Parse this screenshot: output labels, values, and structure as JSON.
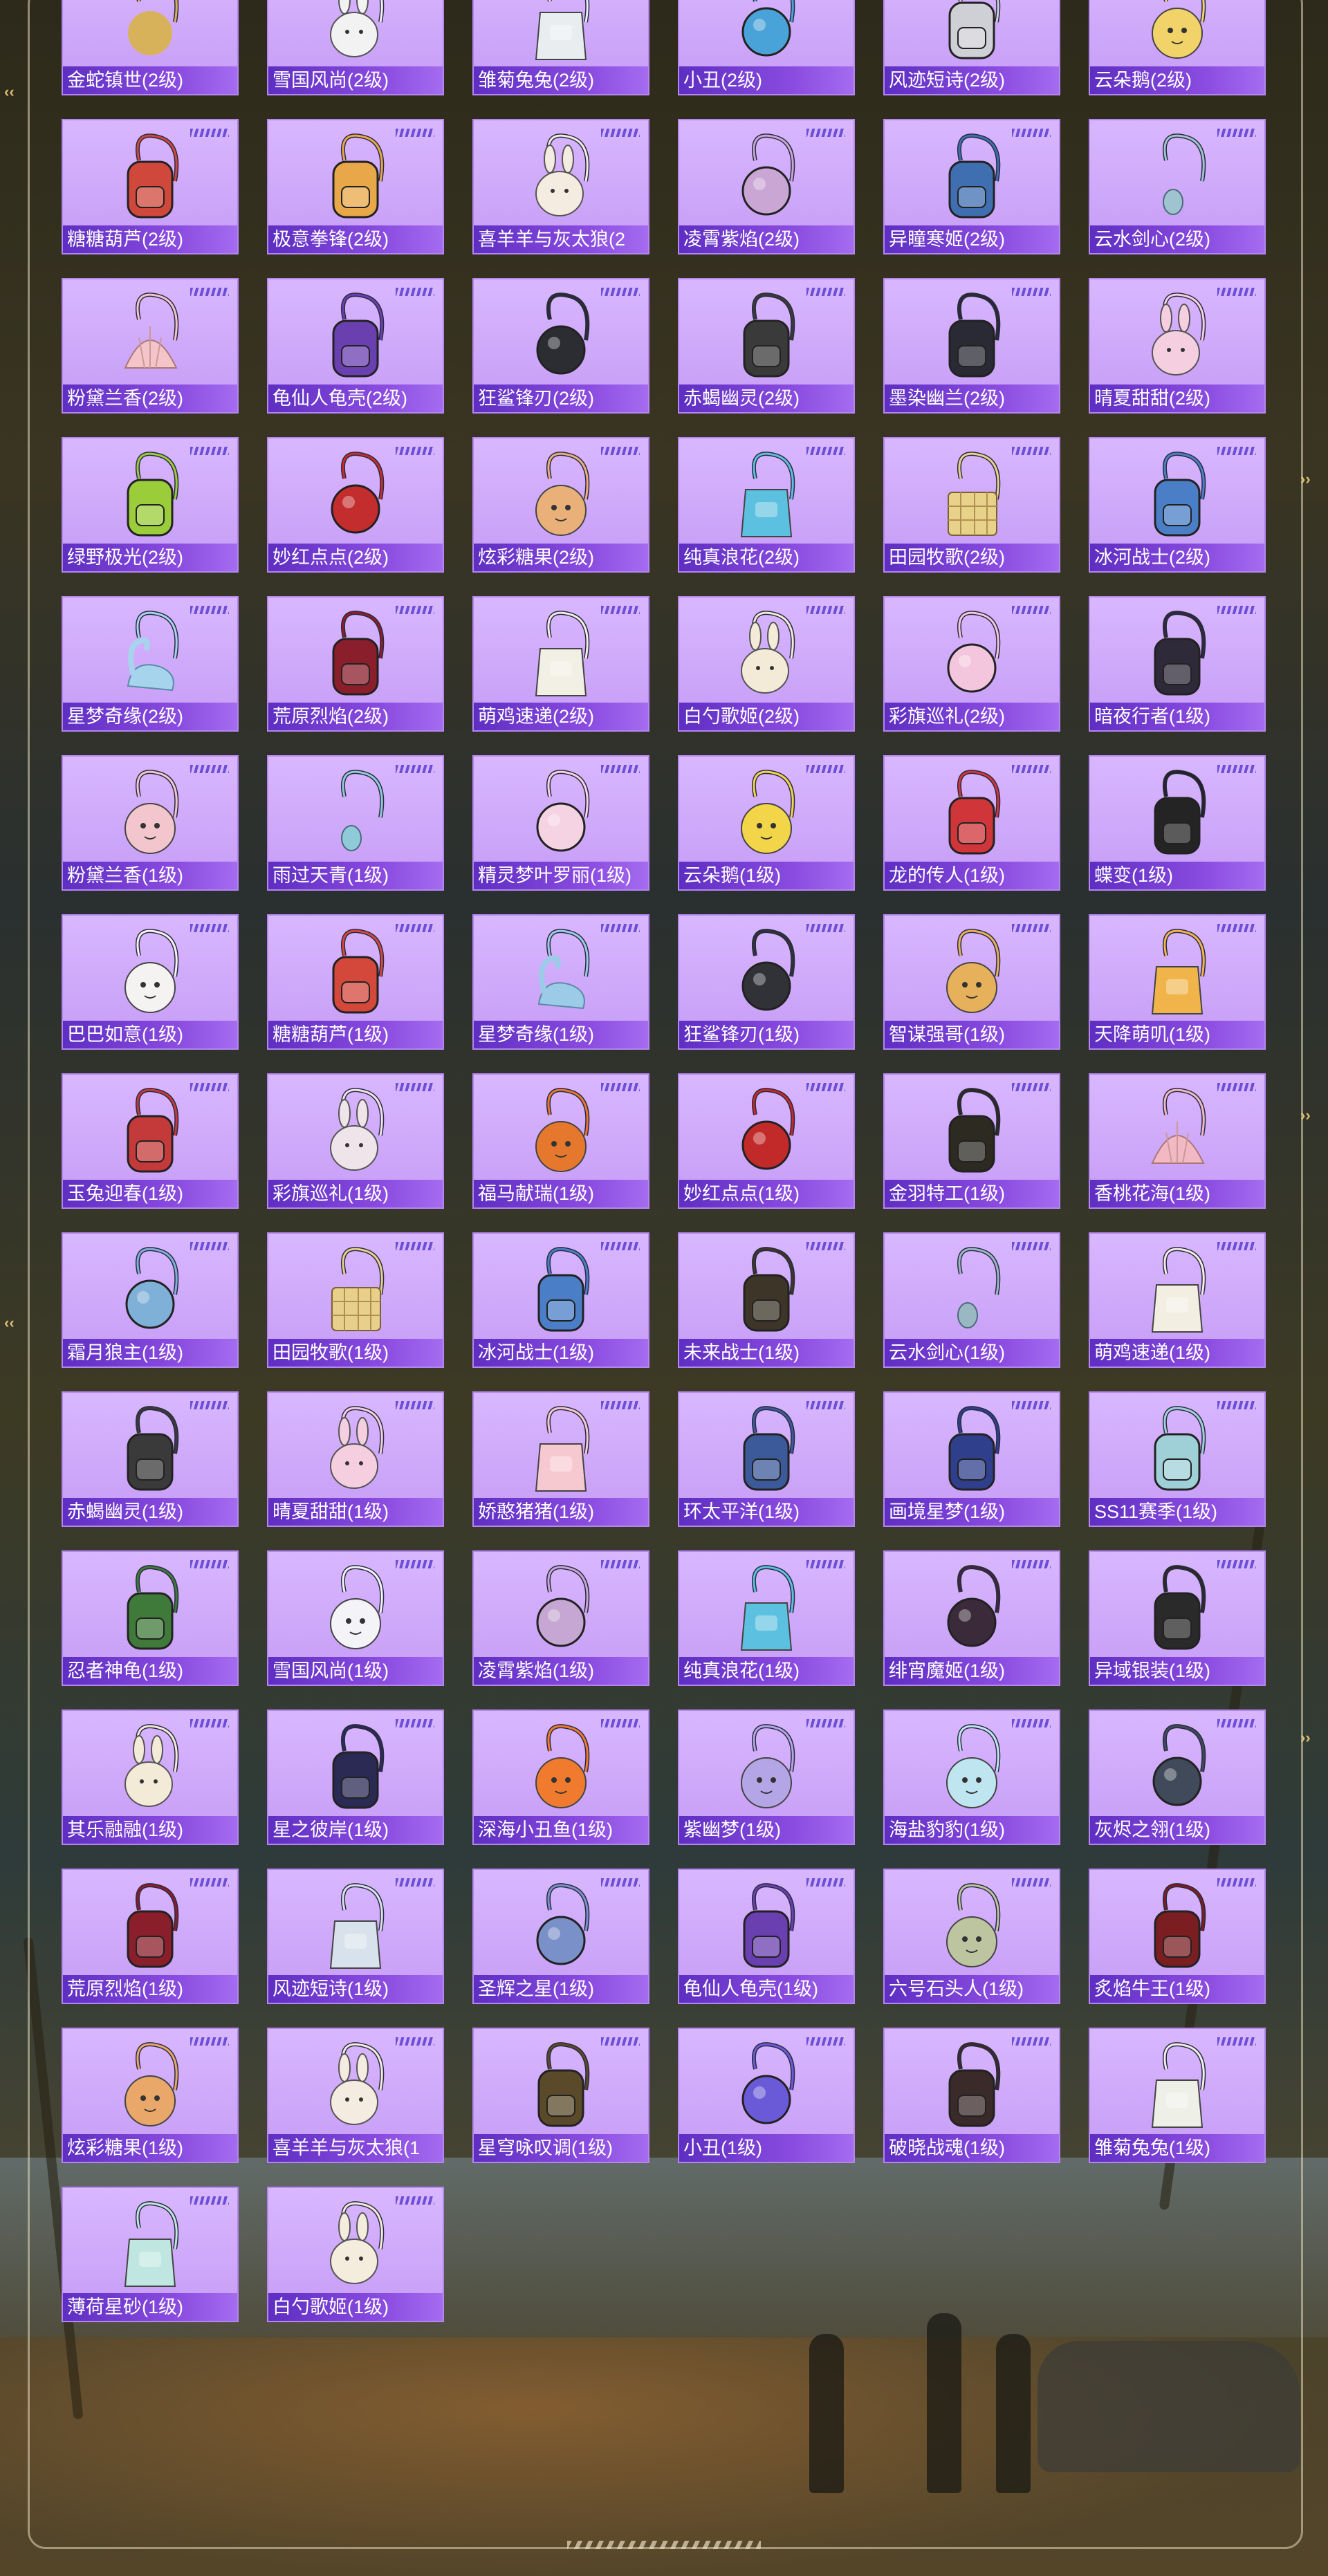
{
  "columns": 6,
  "card_colors": {
    "card": "#d4b0ff",
    "caption_bar": "#6a35cc",
    "text": "#ffffff",
    "accent_stripes": "#6b4fd6"
  },
  "items": [
    {
      "name": "金蛇镇世(2级)",
      "shape": "skull",
      "color": "#d8b25a"
    },
    {
      "name": "雪国风尚(2级)",
      "shape": "bunny",
      "color": "#f2f2f2"
    },
    {
      "name": "雏菊兔兔(2级)",
      "shape": "bag",
      "color": "#e8eef0"
    },
    {
      "name": "小丑(2级)",
      "shape": "orb",
      "color": "#4aa3d8"
    },
    {
      "name": "风迹短诗(2级)",
      "shape": "pack",
      "color": "#cfcfd6"
    },
    {
      "name": "云朵鹅(2级)",
      "shape": "round",
      "color": "#f2d36a"
    },
    {
      "name": "糖糖葫芦(2级)",
      "shape": "pack",
      "color": "#d0483c"
    },
    {
      "name": "极意拳锋(2级)",
      "shape": "pack",
      "color": "#e8a84a"
    },
    {
      "name": "喜羊羊与灰太狼(2",
      "shape": "bunny",
      "color": "#f4ece0"
    },
    {
      "name": "凌霄紫焰(2级)",
      "shape": "orb",
      "color": "#c9a6d4"
    },
    {
      "name": "异瞳寒姬(2级)",
      "shape": "pack",
      "color": "#3f6fb0"
    },
    {
      "name": "云水剑心(2级)",
      "shape": "strap",
      "color": "#9fc3cf"
    },
    {
      "name": "粉黛兰香(2级)",
      "shape": "shell",
      "color": "#f3c4c8"
    },
    {
      "name": "龟仙人龟壳(2级)",
      "shape": "pack",
      "color": "#6a3fb0"
    },
    {
      "name": "狂鲨锋刃(2级)",
      "shape": "orb",
      "color": "#2b2d33"
    },
    {
      "name": "赤蝎幽灵(2级)",
      "shape": "pack",
      "color": "#3a3a3a"
    },
    {
      "name": "墨染幽兰(2级)",
      "shape": "pack",
      "color": "#2a2a35"
    },
    {
      "name": "晴夏甜甜(2级)",
      "shape": "bunny",
      "color": "#f5cfe0"
    },
    {
      "name": "绿野极光(2级)",
      "shape": "pack",
      "color": "#9bcc3a"
    },
    {
      "name": "妙红点点(2级)",
      "shape": "orb",
      "color": "#c42d2d"
    },
    {
      "name": "炫彩糖果(2级)",
      "shape": "round",
      "color": "#e9b07a"
    },
    {
      "name": "纯真浪花(2级)",
      "shape": "bag",
      "color": "#5cc0e0"
    },
    {
      "name": "田园牧歌(2级)",
      "shape": "basket",
      "color": "#e8d28a"
    },
    {
      "name": "冰河战士(2级)",
      "shape": "pack",
      "color": "#4a7fc8"
    },
    {
      "name": "星梦奇缘(2级)",
      "shape": "swan",
      "color": "#a6d4ec"
    },
    {
      "name": "荒原烈焰(2级)",
      "shape": "pack",
      "color": "#8a1e2a"
    },
    {
      "name": "萌鸡速递(2级)",
      "shape": "bag",
      "color": "#f2efe4"
    },
    {
      "name": "白勺歌姬(2级)",
      "shape": "bunny",
      "color": "#f3ead8"
    },
    {
      "name": "彩旗巡礼(2级)",
      "shape": "orb",
      "color": "#f4c6de"
    },
    {
      "name": "暗夜行者(1级)",
      "shape": "pack",
      "color": "#2e2a3a"
    },
    {
      "name": "粉黛兰香(1级)",
      "shape": "round",
      "color": "#f2c6cc"
    },
    {
      "name": "雨过天青(1级)",
      "shape": "strap",
      "color": "#8fcad8"
    },
    {
      "name": "精灵梦叶罗丽(1级)",
      "shape": "orb",
      "color": "#f6d3e2"
    },
    {
      "name": "云朵鹅(1级)",
      "shape": "round",
      "color": "#f3d54a"
    },
    {
      "name": "龙的传人(1级)",
      "shape": "pack",
      "color": "#d0353a"
    },
    {
      "name": "蝶变(1级)",
      "shape": "pack",
      "color": "#242424"
    },
    {
      "name": "巴巴如意(1级)",
      "shape": "round",
      "color": "#f5f2f2"
    },
    {
      "name": "糖糖葫芦(1级)",
      "shape": "pack",
      "color": "#d4483c"
    },
    {
      "name": "星梦奇缘(1级)",
      "shape": "swan",
      "color": "#9ccbe8"
    },
    {
      "name": "狂鲨锋刃(1级)",
      "shape": "orb",
      "color": "#303238"
    },
    {
      "name": "智谋强哥(1级)",
      "shape": "round",
      "color": "#e6b15a"
    },
    {
      "name": "天降萌叽(1级)",
      "shape": "bag",
      "color": "#f0b44a"
    },
    {
      "name": "玉兔迎春(1级)",
      "shape": "pack",
      "color": "#c43a3a"
    },
    {
      "name": "彩旗巡礼(1级)",
      "shape": "bunny",
      "color": "#efe4ea"
    },
    {
      "name": "福马献瑞(1级)",
      "shape": "round",
      "color": "#e6782e"
    },
    {
      "name": "妙红点点(1级)",
      "shape": "orb",
      "color": "#c22a2a"
    },
    {
      "name": "金羽特工(1级)",
      "shape": "pack",
      "color": "#2d2a22"
    },
    {
      "name": "香桃花海(1级)",
      "shape": "shell",
      "color": "#f2b8c4"
    },
    {
      "name": "霜月狼主(1级)",
      "shape": "orb",
      "color": "#7fb0d8"
    },
    {
      "name": "田园牧歌(1级)",
      "shape": "basket",
      "color": "#e8d08a"
    },
    {
      "name": "冰河战士(1级)",
      "shape": "pack",
      "color": "#4a7fc8"
    },
    {
      "name": "未来战士(1级)",
      "shape": "pack",
      "color": "#3d3628"
    },
    {
      "name": "云水剑心(1级)",
      "shape": "strap",
      "color": "#9ab8c4"
    },
    {
      "name": "萌鸡速递(1级)",
      "shape": "bag",
      "color": "#f2eee2"
    },
    {
      "name": "赤蝎幽灵(1级)",
      "shape": "pack",
      "color": "#3a3a3a"
    },
    {
      "name": "晴夏甜甜(1级)",
      "shape": "bunny",
      "color": "#f5cfe0"
    },
    {
      "name": "娇憨猪猪(1级)",
      "shape": "bag",
      "color": "#f6c8d0"
    },
    {
      "name": "环太平洋(1级)",
      "shape": "pack",
      "color": "#3c5a9a"
    },
    {
      "name": "画境星梦(1级)",
      "shape": "pack",
      "color": "#2f3f8c"
    },
    {
      "name": "SS11赛季(1级)",
      "shape": "pack",
      "color": "#9fd0d8"
    },
    {
      "name": "忍者神龟(1级)",
      "shape": "pack",
      "color": "#3f7a3a"
    },
    {
      "name": "雪国风尚(1级)",
      "shape": "round",
      "color": "#f4f4f8"
    },
    {
      "name": "凌霄紫焰(1级)",
      "shape": "orb",
      "color": "#c6a6d2"
    },
    {
      "name": "纯真浪花(1级)",
      "shape": "bag",
      "color": "#5cc0e0"
    },
    {
      "name": "绯宵魔姬(1级)",
      "shape": "orb",
      "color": "#3a2a3a"
    },
    {
      "name": "异域银装(1级)",
      "shape": "pack",
      "color": "#2a2a2a"
    },
    {
      "name": "其乐融融(1级)",
      "shape": "bunny",
      "color": "#f3ead8"
    },
    {
      "name": "星之彼岸(1级)",
      "shape": "pack",
      "color": "#2b2a55"
    },
    {
      "name": "深海小丑鱼(1级)",
      "shape": "round",
      "color": "#f07a2e"
    },
    {
      "name": "紫幽梦(1级)",
      "shape": "round",
      "color": "#b4a6e6"
    },
    {
      "name": "海盐豹豹(1级)",
      "shape": "round",
      "color": "#bfe6f0"
    },
    {
      "name": "灰烬之翎(1级)",
      "shape": "orb",
      "color": "#404a5a"
    },
    {
      "name": "荒原烈焰(1级)",
      "shape": "pack",
      "color": "#8a1e2a"
    },
    {
      "name": "风迹短诗(1级)",
      "shape": "bag",
      "color": "#d8e2ec"
    },
    {
      "name": "圣辉之星(1级)",
      "shape": "orb",
      "color": "#7a90c8"
    },
    {
      "name": "龟仙人龟壳(1级)",
      "shape": "pack",
      "color": "#6a3fb0"
    },
    {
      "name": "六号石头人(1级)",
      "shape": "round",
      "color": "#bcc4a0"
    },
    {
      "name": "炙焰牛王(1级)",
      "shape": "pack",
      "color": "#7a1e22"
    },
    {
      "name": "炫彩糖果(1级)",
      "shape": "round",
      "color": "#e9a86a"
    },
    {
      "name": "喜羊羊与灰太狼(1",
      "shape": "bunny",
      "color": "#f4ece0"
    },
    {
      "name": "星穹咏叹调(1级)",
      "shape": "pack",
      "color": "#5a4a2a"
    },
    {
      "name": "小丑(1级)",
      "shape": "orb",
      "color": "#6a5ad8"
    },
    {
      "name": "破晓战魂(1级)",
      "shape": "pack",
      "color": "#3a2a2a"
    },
    {
      "name": "雏菊兔兔(1级)",
      "shape": "bag",
      "color": "#eef0e8"
    },
    {
      "name": "薄荷星砂(1级)",
      "shape": "bag",
      "color": "#bfe6e0"
    },
    {
      "name": "白勺歌姬(1级)",
      "shape": "bunny",
      "color": "#f4ecdc"
    }
  ]
}
